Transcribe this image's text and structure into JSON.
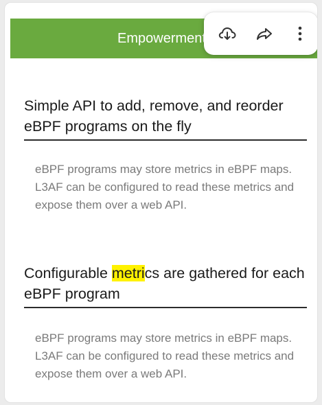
{
  "banner": {
    "title": "Empowerment"
  },
  "toolbar": {
    "icons": [
      "download-icon",
      "share-icon",
      "more-vertical-icon"
    ]
  },
  "sections": [
    {
      "heading": "Simple API to add, remove, and reorder eBPF programs on the fly",
      "body": "eBPF programs may store metrics in eBPF maps. L3AF can be configured to read these metrics and expose them over a web API."
    },
    {
      "heading_before": "Configurable ",
      "heading_highlight": "metri",
      "heading_after": "cs are gathered for each eBPF program",
      "body": "eBPF programs may store metrics in eBPF maps. L3AF can be configured to read these metrics and expose them over a web API."
    }
  ],
  "colors": {
    "banner": "#6aaa3f",
    "highlight": "#fff200",
    "body_text": "#7a7a7a"
  }
}
